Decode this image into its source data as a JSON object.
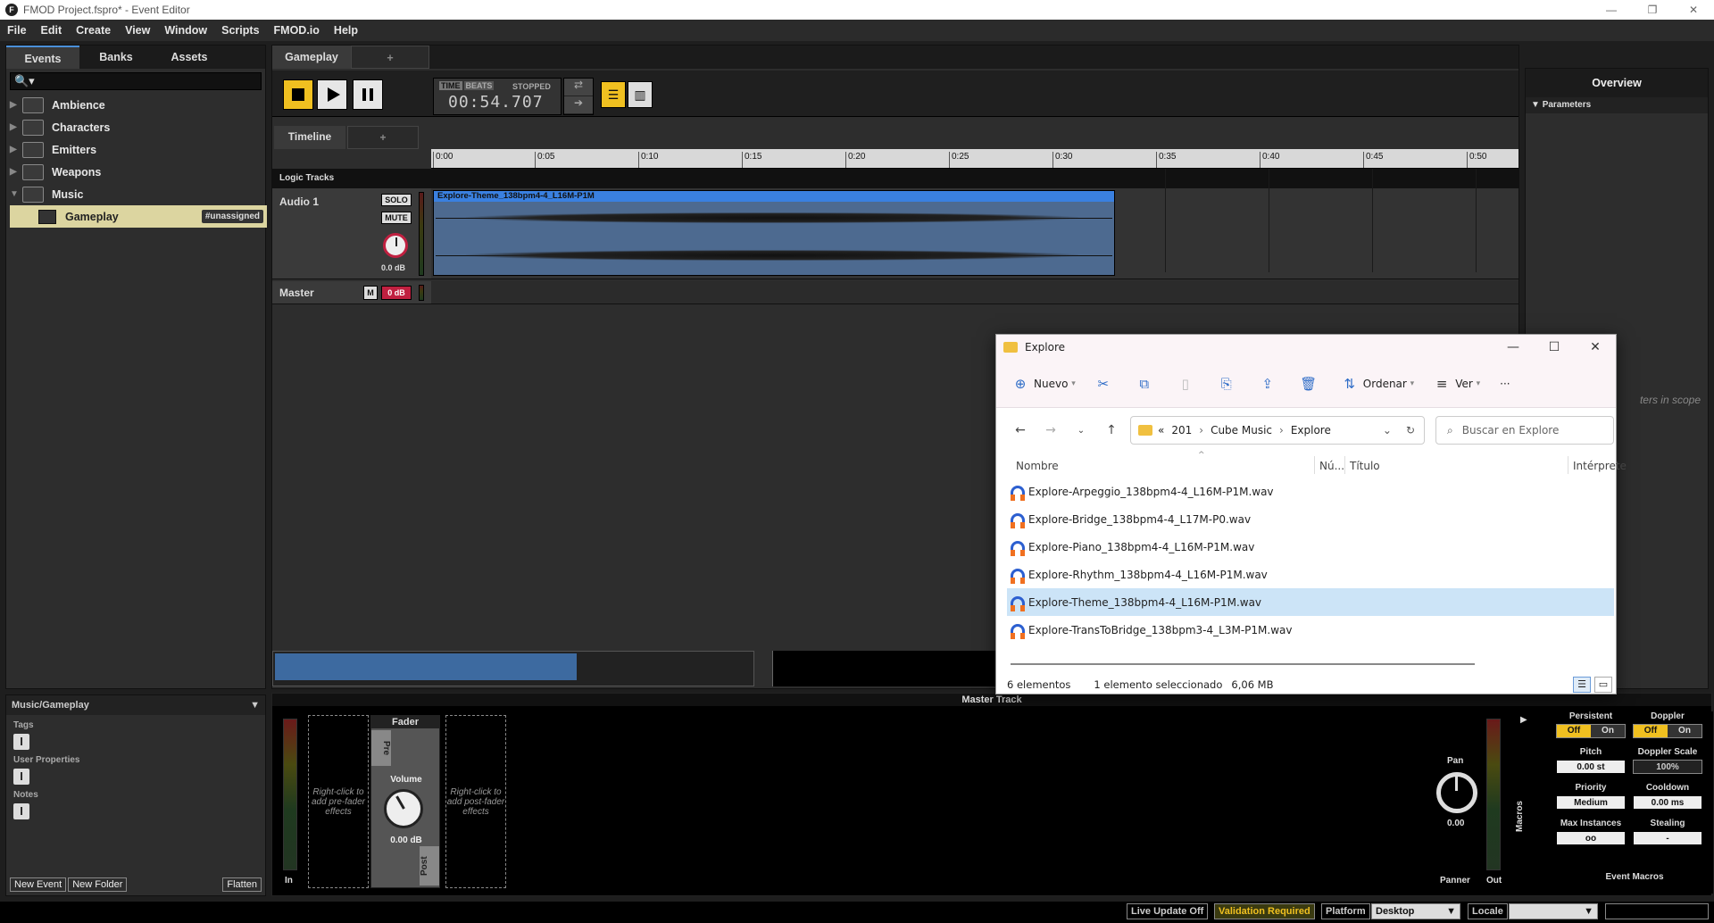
{
  "window": {
    "title": "FMOD Project.fspro* - Event Editor",
    "logo": "F",
    "controls": [
      "—",
      "❐",
      "✕"
    ]
  },
  "menu": [
    "File",
    "Edit",
    "Create",
    "View",
    "Window",
    "Scripts",
    "FMOD.io",
    "Help"
  ],
  "browser": {
    "tabs": [
      "Events",
      "Banks",
      "Assets"
    ],
    "search_glyph": "🔍▾",
    "items": [
      {
        "label": "Ambience",
        "expanded": false
      },
      {
        "label": "Characters",
        "expanded": false
      },
      {
        "label": "Emitters",
        "expanded": false
      },
      {
        "label": "Weapons",
        "expanded": false
      },
      {
        "label": "Music",
        "expanded": true
      }
    ],
    "selected_event": {
      "label": "Gameplay",
      "tag": "#unassigned"
    }
  },
  "properties": {
    "path": "Music/Gameplay",
    "sections": [
      "Tags",
      "User Properties",
      "Notes"
    ],
    "add_glyph": "I",
    "buttons": {
      "new_event": "New Event",
      "new_folder": "New Folder",
      "flatten": "Flatten"
    }
  },
  "editor": {
    "tab": "Gameplay",
    "add_tab": "+",
    "transport": {
      "time_badge": "TIME",
      "beats_badge": "BEATS",
      "state": "STOPPED",
      "time": "00:54.707",
      "loop_glyph": "⇄",
      "follow_glyph": "➔",
      "view1_glyph": "☰",
      "view2_glyph": "▥"
    },
    "subtab": "Timeline",
    "add_subtab": "+",
    "ruler": [
      "0:00",
      "0:05",
      "0:10",
      "0:15",
      "0:20",
      "0:25",
      "0:30",
      "0:35",
      "0:40",
      "0:45",
      "0:50"
    ],
    "logic_tracks_label": "Logic Tracks",
    "tracks": {
      "audio1": {
        "name": "Audio 1",
        "solo": "SOLO",
        "mute": "MUTE",
        "volume": "0.0 dB"
      },
      "master": {
        "name": "Master",
        "m": "M",
        "volume": "0 dB"
      }
    },
    "clip": {
      "name": "Explore-Theme_138bpm4-4_L16M-P1M"
    }
  },
  "overview": {
    "title": "Overview",
    "parameters": "Parameters",
    "scope_text": "ters in scope"
  },
  "deck": {
    "title": "Master Track",
    "pre_fader_hint": "Right-click to add pre-fader effects",
    "post_fader_hint": "Right-click to add post-fader effects",
    "fader": {
      "title": "Fader",
      "pre": "Pre",
      "post": "Post",
      "volume_label": "Volume",
      "volume_value": "0.00 dB"
    },
    "in_label": "In",
    "pan": {
      "label": "Pan",
      "value": "0.00",
      "panner": "Panner"
    },
    "out_label": "Out",
    "macros": {
      "side_label": "Macros",
      "persistent": {
        "label": "Persistent",
        "off": "Off",
        "on": "On"
      },
      "doppler": {
        "label": "Doppler",
        "off": "Off",
        "on": "On"
      },
      "pitch": {
        "label": "Pitch",
        "value": "0.00 st"
      },
      "doppler_scale": {
        "label": "Doppler Scale",
        "value": "100%"
      },
      "priority": {
        "label": "Priority",
        "value": "Medium"
      },
      "cooldown": {
        "label": "Cooldown",
        "value": "0.00 ms"
      },
      "max_instances": {
        "label": "Max Instances",
        "value": "oo"
      },
      "stealing": {
        "label": "Stealing",
        "value": "-"
      },
      "footer": "Event Macros"
    }
  },
  "statusbar": {
    "live_update": "Live Update Off",
    "validation": "Validation Required",
    "platform_label": "Platform",
    "platform_value": "Desktop",
    "locale_label": "Locale"
  },
  "explorer": {
    "title": "Explore",
    "toolbar": {
      "new": "Nuevo",
      "sort": "Ordenar",
      "view": "Ver",
      "more": "···"
    },
    "address": {
      "prefix": "«",
      "crumbs": [
        "201",
        "Cube Music",
        "Explore"
      ]
    },
    "search_placeholder": "Buscar en Explore",
    "columns": [
      "Nombre",
      "Nú...",
      "Título",
      "Intérprete"
    ],
    "files": [
      "Explore-Arpeggio_138bpm4-4_L16M-P1M.wav",
      "Explore-Bridge_138bpm4-4_L17M-P0.wav",
      "Explore-Piano_138bpm4-4_L16M-P1M.wav",
      "Explore-Rhythm_138bpm4-4_L16M-P1M.wav",
      "Explore-Theme_138bpm4-4_L16M-P1M.wav",
      "Explore-TransToBridge_138bpm3-4_L3M-P1M.wav"
    ],
    "selected_index": 4,
    "status": {
      "count": "6 elementos",
      "selected": "1 elemento seleccionado",
      "size": "6,06 MB"
    }
  }
}
